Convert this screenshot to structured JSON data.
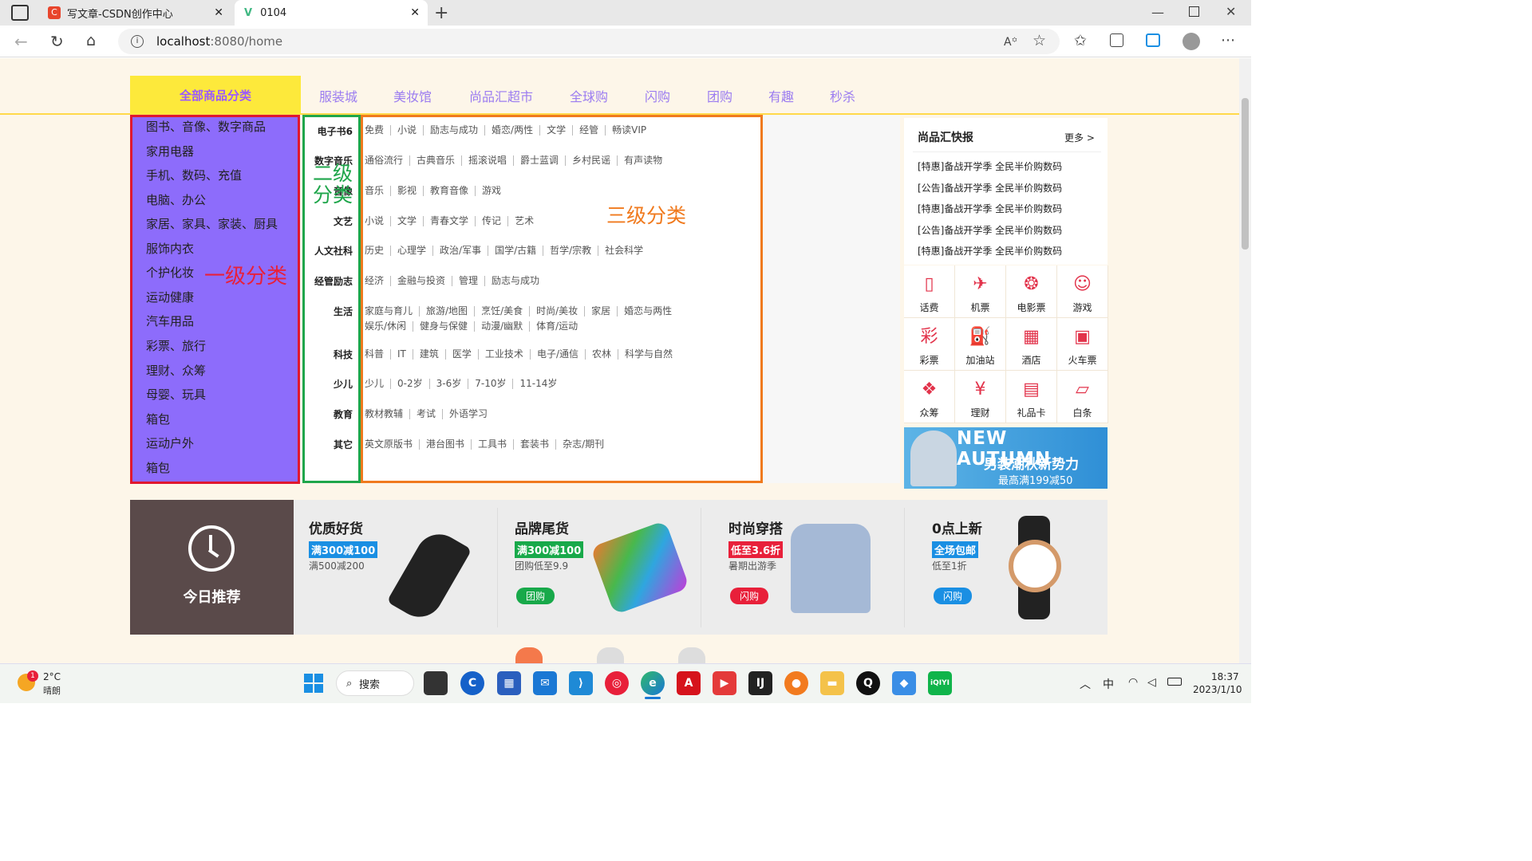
{
  "browser": {
    "tabs": [
      {
        "title": "写文章-CSDN创作中心"
      },
      {
        "title": "0104"
      }
    ],
    "url_host": "localhost",
    "url_rest": ":8080/home"
  },
  "nav": {
    "all_category": "全部商品分类",
    "items": [
      "服装城",
      "美妆馆",
      "尚品汇超市",
      "全球购",
      "闪购",
      "团购",
      "有趣",
      "秒杀"
    ]
  },
  "level1": {
    "items": [
      "图书、音像、数字商品",
      "家用电器",
      "手机、数码、充值",
      "电脑、办公",
      "家居、家具、家装、厨具",
      "服饰内衣",
      "个护化妆",
      "运动健康",
      "汽车用品",
      "彩票、旅行",
      "理财、众筹",
      "母婴、玩具",
      "箱包",
      "运动户外",
      "箱包"
    ],
    "annotation": "一级分类"
  },
  "level2": {
    "annotation_line1": "二级",
    "annotation_line2": "分类"
  },
  "level3": {
    "annotation": "三级分类",
    "rows": [
      {
        "title": "电子书6",
        "items": [
          "免费",
          "小说",
          "励志与成功",
          "婚恋/两性",
          "文学",
          "经管",
          "畅读VIP"
        ]
      },
      {
        "title": "数字音乐",
        "items": [
          "通俗流行",
          "古典音乐",
          "摇滚说唱",
          "爵士蓝调",
          "乡村民谣",
          "有声读物"
        ]
      },
      {
        "title": "音像",
        "items": [
          "音乐",
          "影视",
          "教育音像",
          "游戏"
        ]
      },
      {
        "title": "文艺",
        "items": [
          "小说",
          "文学",
          "青春文学",
          "传记",
          "艺术"
        ]
      },
      {
        "title": "人文社科",
        "items": [
          "历史",
          "心理学",
          "政治/军事",
          "国学/古籍",
          "哲学/宗教",
          "社会科学"
        ]
      },
      {
        "title": "经管励志",
        "items": [
          "经济",
          "金融与投资",
          "管理",
          "励志与成功"
        ]
      },
      {
        "title": "生活",
        "items": [
          "家庭与育儿",
          "旅游/地图",
          "烹饪/美食",
          "时尚/美妆",
          "家居",
          "婚恋与两性"
        ],
        "items2": [
          "娱乐/休闲",
          "健身与保健",
          "动漫/幽默",
          "体育/运动"
        ]
      },
      {
        "title": "科技",
        "items": [
          "科普",
          "IT",
          "建筑",
          "医学",
          "工业技术",
          "电子/通信",
          "农林",
          "科学与自然"
        ]
      },
      {
        "title": "少儿",
        "items": [
          "少儿",
          "0-2岁",
          "3-6岁",
          "7-10岁",
          "11-14岁"
        ]
      },
      {
        "title": "教育",
        "items": [
          "教材教辅",
          "考试",
          "外语学习"
        ]
      },
      {
        "title": "其它",
        "items": [
          "英文原版书",
          "港台图书",
          "工具书",
          "套装书",
          "杂志/期刊"
        ]
      }
    ]
  },
  "news": {
    "title": "尚品汇快报",
    "more": "更多 >",
    "items": [
      "[特惠]备战开学季 全民半价购数码",
      "[公告]备战开学季 全民半价购数码",
      "[特惠]备战开学季 全民半价购数码",
      "[公告]备战开学季 全民半价购数码",
      "[特惠]备战开学季 全民半价购数码"
    ]
  },
  "services": [
    {
      "label": "话费",
      "icon": "phone-bill-icon",
      "glyph": "▯"
    },
    {
      "label": "机票",
      "icon": "plane-icon",
      "glyph": "✈"
    },
    {
      "label": "电影票",
      "icon": "film-icon",
      "glyph": "❂"
    },
    {
      "label": "游戏",
      "icon": "gamepad-icon",
      "glyph": "☺"
    },
    {
      "label": "彩票",
      "icon": "lottery-icon",
      "glyph": "彩"
    },
    {
      "label": "加油站",
      "icon": "gas-station-icon",
      "glyph": "⛽"
    },
    {
      "label": "酒店",
      "icon": "hotel-icon",
      "glyph": "▦"
    },
    {
      "label": "火车票",
      "icon": "train-icon",
      "glyph": "▣"
    },
    {
      "label": "众筹",
      "icon": "crowdfund-icon",
      "glyph": "❖"
    },
    {
      "label": "理财",
      "icon": "finance-icon",
      "glyph": "¥"
    },
    {
      "label": "礼品卡",
      "icon": "gift-card-icon",
      "glyph": "▤"
    },
    {
      "label": "白条",
      "icon": "credit-icon",
      "glyph": "▱"
    }
  ],
  "banner": {
    "line1": "NEW AUTUMN",
    "line2": "男装潮秋新势力",
    "line3": "最高满199减50"
  },
  "recommend": {
    "title": "今日推荐",
    "cards": [
      {
        "title": "优质好货",
        "badge": "满300减100",
        "badge_color": "#1a8fe3",
        "sub": "满500减200",
        "pill": "",
        "product": "vacuum-image"
      },
      {
        "title": "品牌尾货",
        "badge": "满300减100",
        "badge_color": "#18a94a",
        "sub": "团购低至9.9",
        "pill": "团购",
        "pill_color": "#18a94a",
        "product": "towels-image"
      },
      {
        "title": "时尚穿搭",
        "badge": "低至3.6折",
        "badge_color": "#e8203a",
        "sub": "暑期出游季",
        "pill": "闪购",
        "pill_color": "#e8203a",
        "product": "shirt-image"
      },
      {
        "title": "0点上新",
        "badge": "全场包邮",
        "badge_color": "#1a8fe3",
        "sub": "低至1折",
        "pill": "闪购",
        "pill_color": "#1a8fe3",
        "product": "watch-image"
      }
    ]
  },
  "taskbar": {
    "weather_temp": "2°C",
    "weather_desc": "晴朗",
    "weather_badge": "1",
    "search": "搜索",
    "ime": "中",
    "time": "18:37",
    "date": "2023/1/10"
  }
}
